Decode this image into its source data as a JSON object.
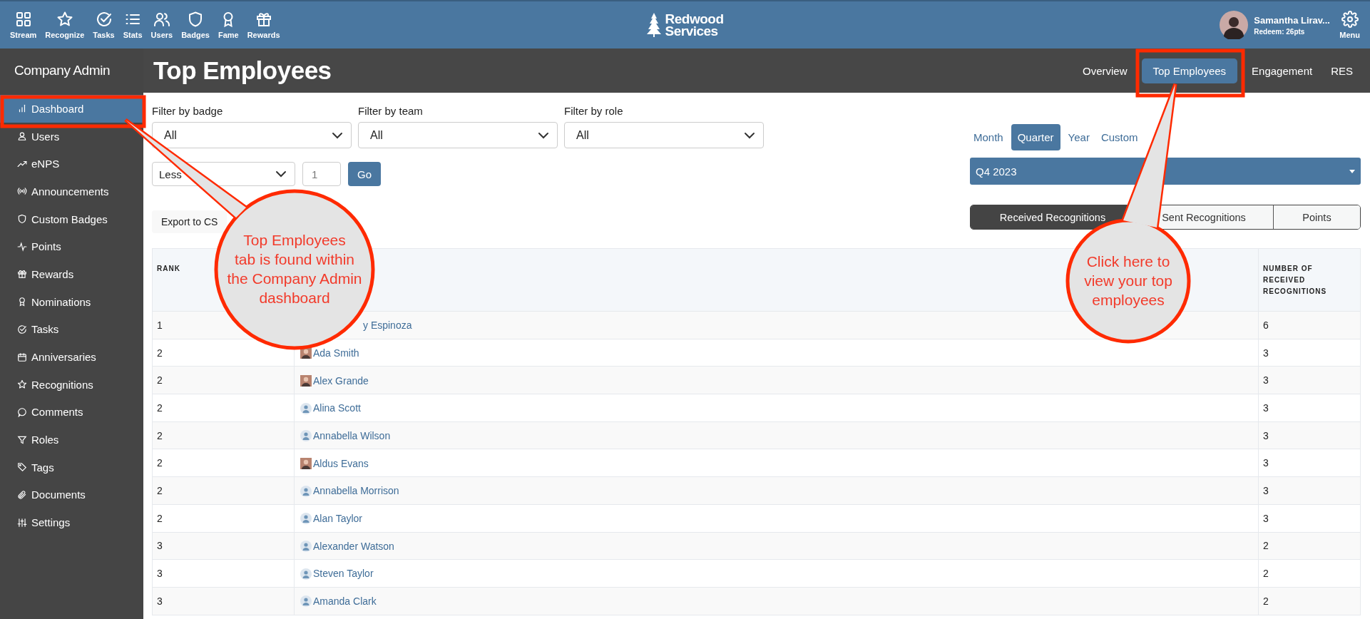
{
  "top_nav": {
    "items": [
      {
        "label": "Stream"
      },
      {
        "label": "Recognize"
      },
      {
        "label": "Tasks"
      },
      {
        "label": "Stats"
      },
      {
        "label": "Users"
      },
      {
        "label": "Badges"
      },
      {
        "label": "Fame"
      },
      {
        "label": "Rewards"
      }
    ]
  },
  "logo": {
    "line_1": "Redwood",
    "line_2": "Services"
  },
  "user": {
    "name": "Samantha Lirav...",
    "points": "Redeem: 26pts"
  },
  "menu": {
    "label": "Menu"
  },
  "sidebar": {
    "title": "Company Admin",
    "items": [
      {
        "label": "Dashboard",
        "selected": true
      },
      {
        "label": "Users",
        "selected": false
      },
      {
        "label": "eNPS",
        "selected": false
      },
      {
        "label": "Announcements",
        "selected": false
      },
      {
        "label": "Custom Badges",
        "selected": false
      },
      {
        "label": "Points",
        "selected": false
      },
      {
        "label": "Rewards",
        "selected": false
      },
      {
        "label": "Nominations",
        "selected": false
      },
      {
        "label": "Tasks",
        "selected": false
      },
      {
        "label": "Anniversaries",
        "selected": false
      },
      {
        "label": "Recognitions",
        "selected": false
      },
      {
        "label": "Comments",
        "selected": false
      },
      {
        "label": "Roles",
        "selected": false
      },
      {
        "label": "Tags",
        "selected": false
      },
      {
        "label": "Documents",
        "selected": false
      },
      {
        "label": "Settings",
        "selected": false
      }
    ]
  },
  "page": {
    "title": "Top Employees",
    "tabs": [
      {
        "label": "Overview",
        "selected": false
      },
      {
        "label": "Top Employees",
        "selected": true
      },
      {
        "label": "Engagement",
        "selected": false
      },
      {
        "label": "RES",
        "selected": false
      }
    ]
  },
  "filters": [
    {
      "label": "Filter by badge",
      "value": "All"
    },
    {
      "label": "Filter by team",
      "value": "All"
    },
    {
      "label": "Filter by role",
      "value": "All"
    }
  ],
  "threshold": {
    "comparison": "Less",
    "amount": "1",
    "button": "Go"
  },
  "export_button": "Export to CS",
  "period_tabs": [
    {
      "label": "Month",
      "selected": false
    },
    {
      "label": "Quarter",
      "selected": true
    },
    {
      "label": "Year",
      "selected": false
    },
    {
      "label": "Custom",
      "selected": false
    }
  ],
  "period": "Q4 2023",
  "metric_tabs": [
    {
      "label": "Received Recognitions",
      "selected": true
    },
    {
      "label": "Sent Recognitions",
      "selected": false
    },
    {
      "label": "Points",
      "selected": false
    }
  ],
  "table": {
    "rank_header": "RANK",
    "count_header": "NUMBER OF RECEIVED RECOGNITIONS",
    "rows": [
      {
        "rank": "1",
        "name": "y Espinoza",
        "count": "6"
      },
      {
        "rank": "2",
        "kind": "photo",
        "name": "Ada Smith",
        "count": "3"
      },
      {
        "rank": "2",
        "kind": "photo",
        "name": "Alex Grande",
        "count": "3"
      },
      {
        "rank": "2",
        "kind": "placeholder",
        "name": "Alina Scott",
        "count": "3"
      },
      {
        "rank": "2",
        "kind": "placeholder",
        "name": "Annabella Wilson",
        "count": "3"
      },
      {
        "rank": "2",
        "kind": "photo",
        "name": "Aldus Evans",
        "count": "3"
      },
      {
        "rank": "2",
        "kind": "placeholder",
        "name": "Annabella Morrison",
        "count": "3"
      },
      {
        "rank": "2",
        "kind": "placeholder",
        "name": "Alan Taylor",
        "count": "3"
      },
      {
        "rank": "3",
        "kind": "placeholder",
        "name": "Alexander Watson",
        "count": "2"
      },
      {
        "rank": "3",
        "kind": "placeholder",
        "name": "Steven Taylor",
        "count": "2"
      },
      {
        "rank": "3",
        "kind": "placeholder",
        "name": "Amanda Clark",
        "count": "2"
      }
    ]
  },
  "annotations": [
    {
      "kind": "callout",
      "text": "Top Employees\ntab is found within\nthe Company Admin\ndashboard"
    },
    {
      "kind": "callout",
      "text": "Click here to\nview your top\nemployees"
    }
  ]
}
